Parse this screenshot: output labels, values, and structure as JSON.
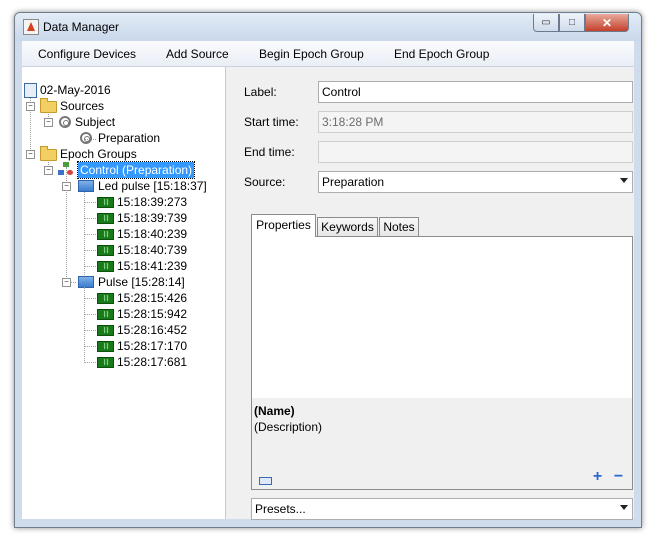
{
  "window": {
    "title": "Data Manager",
    "minimize_glyph": "▭",
    "maximize_glyph": "□",
    "close_glyph": "✕"
  },
  "menu": {
    "items": [
      "Configure Devices",
      "Add Source",
      "Begin Epoch Group",
      "End Epoch Group"
    ]
  },
  "tree": {
    "root": "02-May-2016",
    "sources_label": "Sources",
    "subject_label": "Subject",
    "preparation_label": "Preparation",
    "epoch_groups_label": "Epoch Groups",
    "selected_group_label": "Control (Preparation)",
    "blocks": [
      {
        "label": "Led pulse [15:18:37]",
        "epochs": [
          "15:18:39:273",
          "15:18:39:739",
          "15:18:40:239",
          "15:18:40:739",
          "15:18:41:239"
        ]
      },
      {
        "label": "Pulse [15:28:14]",
        "epochs": [
          "15:28:15:426",
          "15:28:15:942",
          "15:28:16:452",
          "15:28:17:170",
          "15:28:17:681"
        ]
      }
    ],
    "epoch_icon_glyph": "⌇⌇"
  },
  "form": {
    "label_caption": "Label:",
    "label_value": "Control",
    "start_caption": "Start time:",
    "start_value": "3:18:28 PM",
    "end_caption": "End time:",
    "end_value": "",
    "source_caption": "Source:",
    "source_value": "Preparation"
  },
  "tabs": [
    "Properties",
    "Keywords",
    "Notes"
  ],
  "properties": {
    "name_placeholder": "(Name)",
    "description_placeholder": "(Description)",
    "add_glyph": "+",
    "remove_glyph": "−"
  },
  "presets": {
    "value": "Presets..."
  },
  "colors": {
    "selection": "#3399ff",
    "accent": "#2b67d1",
    "title_bg": "#cfdcec"
  }
}
